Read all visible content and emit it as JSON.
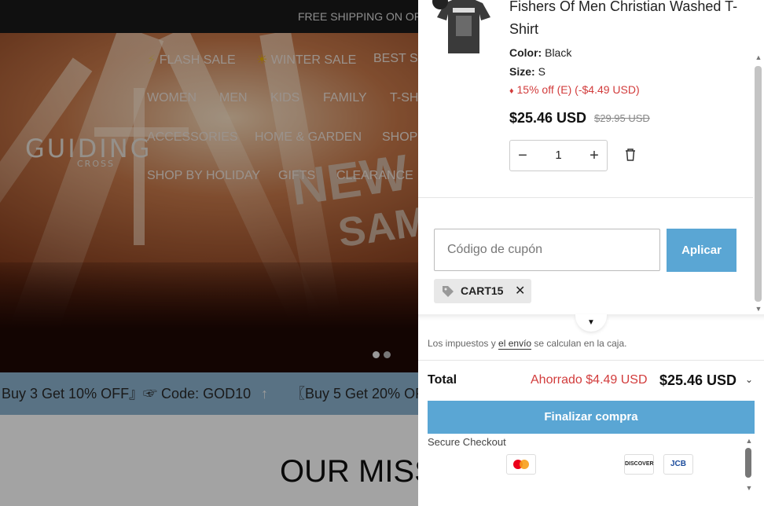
{
  "announcement": "FREE SHIPPING ON ORDE",
  "hero": {
    "logo_text": "GUIDING",
    "logo_sub": "CROSS",
    "nav": [
      {
        "label": "FLASH SALE",
        "icon": "lightning-icon"
      },
      {
        "label": "WINTER SALE",
        "icon": "sun-icon"
      },
      {
        "label": "BEST SE"
      },
      {
        "label": "WOMEN"
      },
      {
        "label": "MEN"
      },
      {
        "label": "KIDS"
      },
      {
        "label": "FAMILY"
      },
      {
        "label": "T-SH"
      },
      {
        "label": "ACCESSORIES"
      },
      {
        "label": "HOME & GARDEN"
      },
      {
        "label": "SHOP"
      },
      {
        "label": "SHOP BY HOLIDAY"
      },
      {
        "label": "GIFTS"
      },
      {
        "label": "CLEARANCE"
      }
    ],
    "banner_text_1": "NEW",
    "banner_text_2": "SAME"
  },
  "promo_band": {
    "left": "Buy 3 Get 10% OFF』☞ Code: GOD10",
    "right": "〖Buy 5 Get 20% OF"
  },
  "mission_title": "OUR MISS",
  "cart": {
    "item": {
      "name": "Fishers Of Men Christian Washed T-Shirt",
      "color_label": "Color:",
      "color": "Black",
      "size_label": "Size:",
      "size": "S",
      "discount": "15% off (E) (-$4.49 USD)",
      "price": "$25.46 USD",
      "old_price": "$29.95 USD",
      "quantity": "1",
      "minus": "−",
      "plus": "+"
    },
    "coupon": {
      "placeholder": "Código de cupón",
      "apply_label": "Aplicar",
      "applied_code": "CART15",
      "remove": "✕"
    },
    "tax_before": "Los impuestos y ",
    "tax_link": "el envío",
    "tax_after": " se calculan en la caja.",
    "total_label": "Total",
    "saved": "Ahorrado $4.49 USD",
    "total_value": "$25.46 USD",
    "checkout_label": "Finalizar compra",
    "secure_label": "Secure Checkout",
    "payment_icons": [
      "mastercard-icon",
      "discover-icon",
      "jcb-icon"
    ],
    "discover_text": "DISCOVER",
    "jcb_text": "JCB"
  },
  "colors": {
    "accent": "#5aa6d4",
    "discount_red": "#d23c3c",
    "promo_band": "#8bb3cf"
  }
}
